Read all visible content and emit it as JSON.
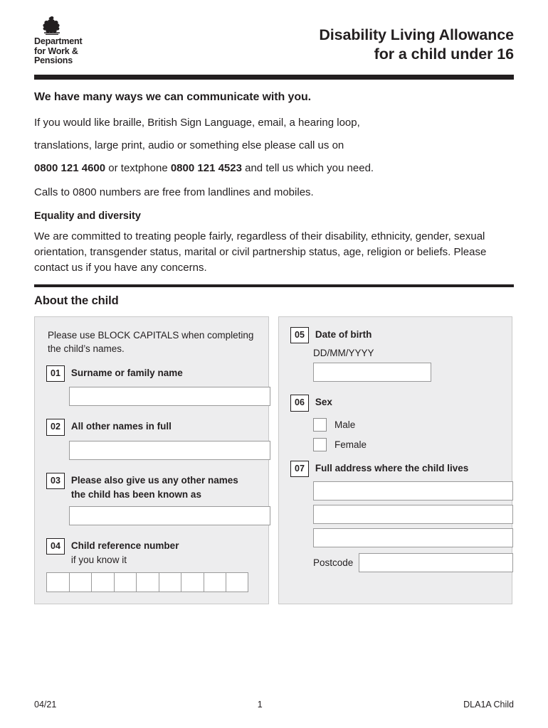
{
  "header": {
    "logo_lines": [
      "Department",
      "for Work &",
      "Pensions"
    ],
    "crest_icon": "royal-crest-icon",
    "title_line1": "Disability Living Allowance",
    "title_line2": "for a child under 16"
  },
  "comms": {
    "heading": "We have many ways we can communicate with you.",
    "para1": "If you would like braille, British Sign Language, email, a hearing loop,",
    "para2_pre": "translations, large print, audio or something else please call us on",
    "phone1": "0800 121 4600",
    "phone_mid": " or textphone ",
    "phone2": "0800 121 4523",
    "phone_post": " and tell us which you need.",
    "para3": "Calls to 0800 numbers are free from landlines and mobiles.",
    "equality_title": "Equality and diversity",
    "equality_body": "We are committed to treating people fairly, regardless of their disability, ethnicity, gender, sexual orientation, transgender status, marital or civil partnership status, age, religion or beliefs. Please contact us if you have any concerns."
  },
  "about_child": {
    "section_title": "About the child",
    "instruction": "Please use BLOCK CAPITALS when completing the child’s names.",
    "q01": {
      "num": "01",
      "label": "Surname or family name",
      "value": ""
    },
    "q02": {
      "num": "02",
      "label": "All other names in full",
      "value": ""
    },
    "q03": {
      "num": "03",
      "label_line1": "Please also give us any other names",
      "label_line2": "the child has been known as",
      "value": ""
    },
    "q04": {
      "num": "04",
      "label": "Child reference number",
      "hint": "if you know it",
      "cells": 9,
      "values": [
        "",
        "",
        "",
        "",
        "",
        "",
        "",
        "",
        ""
      ]
    },
    "q05": {
      "num": "05",
      "label": "Date of birth",
      "hint": "DD/MM/YYYY",
      "value": ""
    },
    "q06": {
      "num": "06",
      "label": "Sex",
      "options": [
        {
          "label": "Male",
          "checked": false
        },
        {
          "label": "Female",
          "checked": false
        }
      ]
    },
    "q07": {
      "num": "07",
      "label": "Full address where the child lives",
      "lines": [
        "",
        "",
        ""
      ],
      "postcode_label": "Postcode",
      "postcode_value": ""
    }
  },
  "footer": {
    "left": "04/21",
    "center": "1",
    "right": "DLA1A Child"
  }
}
